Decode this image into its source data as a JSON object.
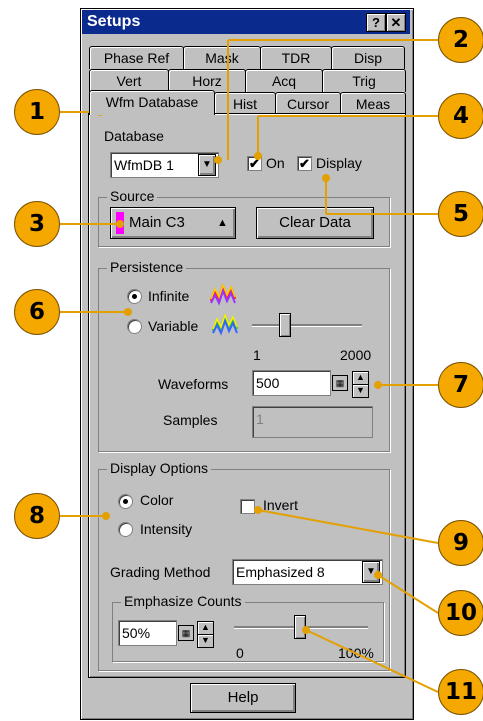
{
  "window": {
    "title": "Setups",
    "help_glyph": "?",
    "close_glyph": "✕"
  },
  "tabs": {
    "row1": [
      "Phase Ref",
      "Mask",
      "TDR",
      "Disp"
    ],
    "row2": [
      "Vert",
      "Horz",
      "Acq",
      "Trig"
    ],
    "row3": [
      "Wfm Database",
      "Hist",
      "Cursor",
      "Meas"
    ]
  },
  "database": {
    "label": "Database",
    "selected": "WfmDB 1",
    "on_label": "On",
    "on_checked": true,
    "display_label": "Display",
    "display_checked": true
  },
  "source": {
    "label": "Source",
    "value": "Main C3",
    "swatch_color": "#ff00ff",
    "clear_button": "Clear Data"
  },
  "persistence": {
    "label": "Persistence",
    "infinite_label": "Infinite",
    "variable_label": "Variable",
    "selected": "Infinite",
    "slider_min": "1",
    "slider_max": "2000",
    "waveforms_label": "Waveforms",
    "waveforms_value": "500",
    "samples_label": "Samples",
    "samples_value": "1"
  },
  "display_options": {
    "label": "Display Options",
    "color_label": "Color",
    "intensity_label": "Intensity",
    "selected": "Color",
    "invert_label": "Invert",
    "invert_checked": false,
    "grading_label": "Grading Method",
    "grading_value": "Emphasized 8"
  },
  "emphasize": {
    "label": "Emphasize Counts",
    "value": "50%",
    "min": "0",
    "max": "100%"
  },
  "help_button": "Help",
  "callouts": [
    "1",
    "2",
    "3",
    "4",
    "5",
    "6",
    "7",
    "8",
    "9",
    "10",
    "11"
  ],
  "colors": {
    "callout": "#f5a800",
    "titlebar": "#0a2a8e",
    "dialog": "#c0c0c0"
  }
}
